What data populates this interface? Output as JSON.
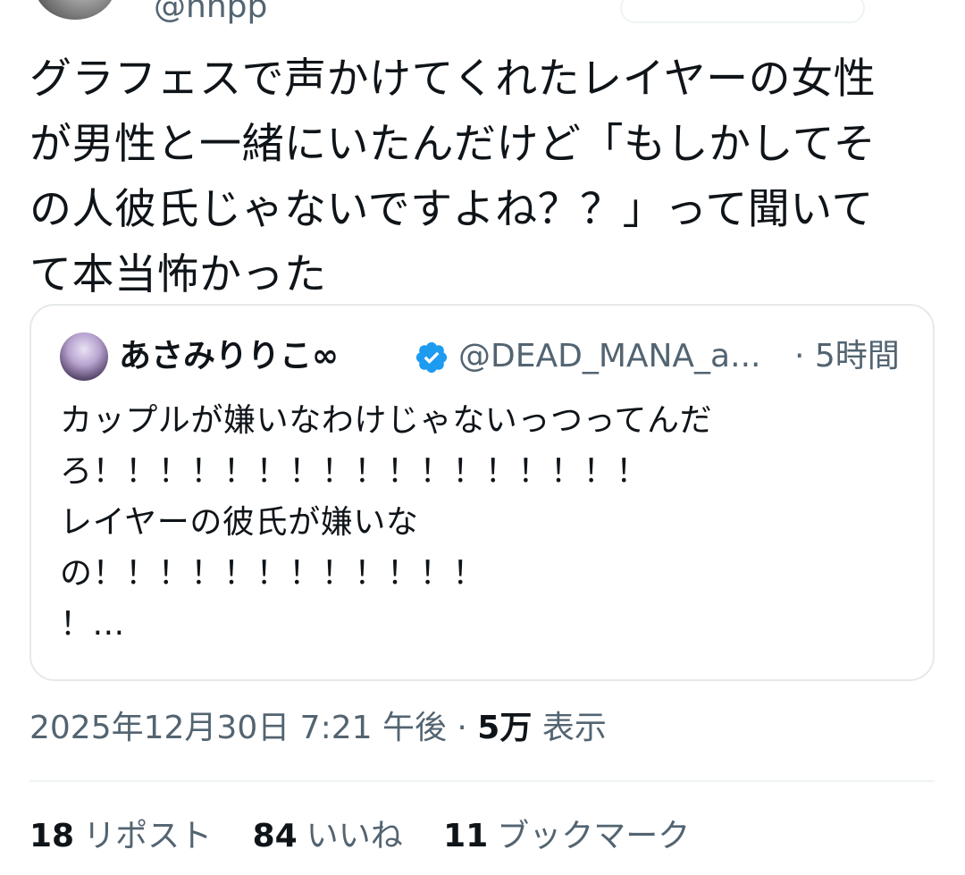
{
  "header": {
    "handle": "@hnpp"
  },
  "tweet": {
    "text": "グラフェスで声かけてくれたレイヤーの女性\nが男性と一緒にいたんだけど「もしかしてそ\nの人彼氏じゃないですよね？？」って聞いて\nて本当怖かった"
  },
  "quote": {
    "name": "あさみりりこ∞",
    "handle": "@DEAD_MANA_a...",
    "time": "· 5時間",
    "text": "カップルが嫌いなわけじゃないっつってんだ\nろ！！！！！！！！！！！！！！！！！\nレイヤーの彼氏が嫌いな\nの！！！！！！！！！！！！\n！..."
  },
  "meta": {
    "datetime": "2025年12月30日 7:21 午後 · ",
    "views_count": "5万",
    "views_label": "表示"
  },
  "stats": [
    {
      "count": "18",
      "label": "リポスト"
    },
    {
      "count": "84",
      "label": "いいね"
    },
    {
      "count": "11",
      "label": "ブックマーク"
    }
  ],
  "colors": {
    "text_primary": "#0f1419",
    "text_secondary": "#536471",
    "border": "#e6e9ea",
    "verified": "#1d9bf0"
  },
  "icons": {
    "verified": "verified-badge-icon"
  }
}
